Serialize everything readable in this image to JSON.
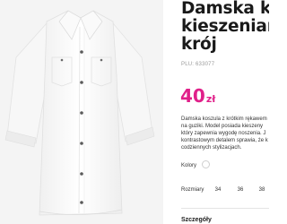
{
  "product": {
    "title_lines": [
      "Damska ko",
      "kieszeniam",
      "krój"
    ],
    "sku": "PLU: 633077",
    "price": {
      "amount": "40",
      "currency": "zł"
    },
    "description_lines": [
      "Damska koszula z krótkim rękawem",
      "na guziki. Model posiada kieszeny",
      "który zapewnia wygodę noszenia. J",
      "kontrastowym detalem sprawia, że k",
      "codziennych stylizacjach."
    ],
    "colors_label": "Kolory",
    "selected_color": "#ffffff",
    "sizes_label": "Rozmiary",
    "sizes": [
      "34",
      "36",
      "38",
      "4"
    ],
    "details_heading": "Szczegóły"
  },
  "colors": {
    "accent": "#e0208a",
    "image_bg": "#f4f4f4"
  },
  "image": {
    "icon": "white-shirt-photo"
  }
}
